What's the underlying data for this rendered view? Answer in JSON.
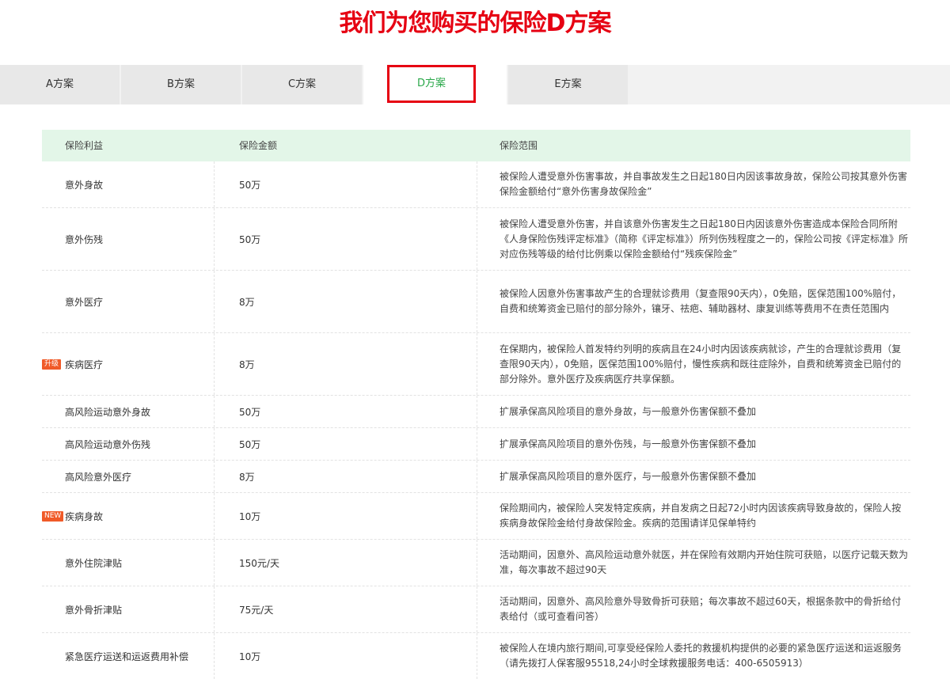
{
  "page": {
    "title": "我们为您购买的保险D方案"
  },
  "tabs": [
    {
      "label": "A方案"
    },
    {
      "label": "B方案"
    },
    {
      "label": "C方案"
    },
    {
      "label": "D方案",
      "active": true
    },
    {
      "label": "E方案"
    }
  ],
  "colors": {
    "title": "#e60012",
    "active_tab_text": "#2aa84a",
    "header_bg": "#e3f6e8",
    "badge": "#f05a28"
  },
  "table": {
    "headers": {
      "benefit": "保险利益",
      "amount": "保险金额",
      "scope": "保险范围"
    },
    "rows": [
      {
        "benefit": "意外身故",
        "amount": "50万",
        "badge": "",
        "scope": "被保险人遭受意外伤害事故，并自事故发生之日起180日内因该事故身故，保险公司按其意外伤害保险金额给付“意外伤害身故保险金”"
      },
      {
        "benefit": "意外伤残",
        "amount": "50万",
        "badge": "",
        "scope": "被保险人遭受意外伤害，并自该意外伤害发生之日起180日内因该意外伤害造成本保险合同所附《人身保险伤残评定标准》（简称《评定标准》）所列伤残程度之一的，保险公司按《评定标准》所对应伤残等级的给付比例乘以保险金额给付“残疾保险金”"
      },
      {
        "benefit": "意外医疗",
        "amount": "8万",
        "badge": "",
        "scope": "被保险人因意外伤害事故产生的合理就诊费用（复查限90天内），0免赔，医保范围100%赔付，自费和统筹资金已赔付的部分除外，镶牙、祛疤、辅助器材、康复训练等费用不在责任范围内"
      },
      {
        "benefit": "疾病医疗",
        "amount": "8万",
        "badge": "升级",
        "scope": "在保期内，被保险人首发特约列明的疾病且在24小时内因该疾病就诊，产生的合理就诊费用（复查限90天内），0免赔，医保范围100%赔付，慢性疾病和既往症除外，自费和统筹资金已赔付的部分除外。意外医疗及疾病医疗共享保额。"
      },
      {
        "benefit": "高风险运动意外身故",
        "amount": "50万",
        "badge": "",
        "scope": "扩展承保高风险项目的意外身故，与一般意外伤害保额不叠加"
      },
      {
        "benefit": "高风险运动意外伤残",
        "amount": "50万",
        "badge": "",
        "scope": "扩展承保高风险项目的意外伤残，与一般意外伤害保额不叠加"
      },
      {
        "benefit": "高风险意外医疗",
        "amount": "8万",
        "badge": "",
        "scope": "扩展承保高风险项目的意外医疗，与一般意外伤害保额不叠加"
      },
      {
        "benefit": "疾病身故",
        "amount": "10万",
        "badge": "NEW",
        "scope": "保险期间内，被保险人突发特定疾病，并自发病之日起72小时内因该疾病导致身故的，保险人按疾病身故保险金给付身故保险金。疾病的范围请详见保单特约"
      },
      {
        "benefit": "意外住院津贴",
        "amount": "150元/天",
        "badge": "",
        "scope": "活动期间，因意外、高风险运动意外就医，并在保险有效期内开始住院可获赔，以医疗记载天数为准，每次事故不超过90天"
      },
      {
        "benefit": "意外骨折津贴",
        "amount": "75元/天",
        "badge": "",
        "scope": "活动期间，因意外、高风险意外导致骨折可获赔；每次事故不超过60天，根据条款中的骨折给付表给付（或可查看问答）"
      },
      {
        "benefit": "紧急医疗运送和运返费用补偿",
        "amount": "10万",
        "badge": "",
        "scope": "被保险人在境内旅行期间,可享受经保险人委托的救援机构提供的必要的紧急医疗运送和运返服务（请先拨打人保客服95518,24小时全球救援服务电话：400-6505913）"
      }
    ]
  }
}
